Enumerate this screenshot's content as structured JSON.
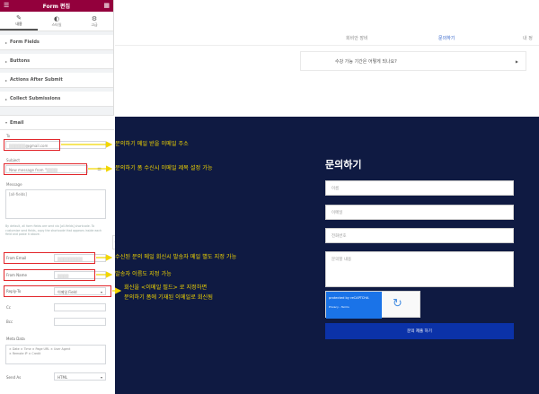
{
  "panel": {
    "title": "Form 편집",
    "tabs": [
      {
        "label": "내용",
        "icon": "pencil-icon"
      },
      {
        "label": "스타일",
        "icon": "half-circle-icon"
      },
      {
        "label": "고급",
        "icon": "gear-icon"
      }
    ],
    "sections": [
      "Form Fields",
      "Buttons",
      "Actions After Submit",
      "Collect Submissions"
    ],
    "email": {
      "heading": "Email",
      "to_label": "To",
      "to_value": "@gmail.com",
      "subject_label": "Subject",
      "subject_value": "New message from \"",
      "message_label": "Message",
      "message_value": "[all-fields]",
      "note": "By default, all form fields are sent via [all-fields] shortcode. To customize sent fields, copy the shortcode that appears inside each field and paste it above.",
      "from_email_label": "From Email",
      "from_name_label": "From Name",
      "reply_to_label": "Reply-To",
      "reply_to_value": "이메일 Field",
      "cc_label": "Cc",
      "bcc_label": "Bcc",
      "meta_label": "Meta Data",
      "meta_tags": [
        "Date",
        "Time",
        "Page URL",
        "User Agent",
        "Remote IP",
        "Credit"
      ],
      "send_as_label": "Send As",
      "send_as_value": "HTML"
    }
  },
  "site": {
    "nav": [
      "회비안 장비",
      "문의하기",
      "내 정"
    ],
    "nav_active": 1,
    "faq_question": "수강 가능 기간은 어떻게 되나요?",
    "form_title": "문의하기",
    "placeholders": [
      "이름",
      "이메일",
      "전화번호",
      "문의할 내용"
    ],
    "recaptcha_title": "protected by reCAPTCHA",
    "recaptcha_sub": "Privacy - Terms",
    "submit_label": "문의 제출 하기"
  },
  "annotations": [
    "문의하기 메일 받을 이메일 주소",
    "문의하기 폼 수신시 이메일 제목 설정 가능",
    "수신된 문의 메일 회신시 발송자 메일 별도 지정 가능",
    "발송자 이름도 지정 가능",
    "회신을 <이메일 필드> 로 지정하면",
    "문의하기 폼에 기재된 이메일로 회신됨"
  ],
  "colors": {
    "panel_header": "#93003c",
    "highlight": "#e2262b",
    "annotation": "#f2d600",
    "dark_bg": "#0f1a42",
    "submit": "#0b32a8"
  }
}
